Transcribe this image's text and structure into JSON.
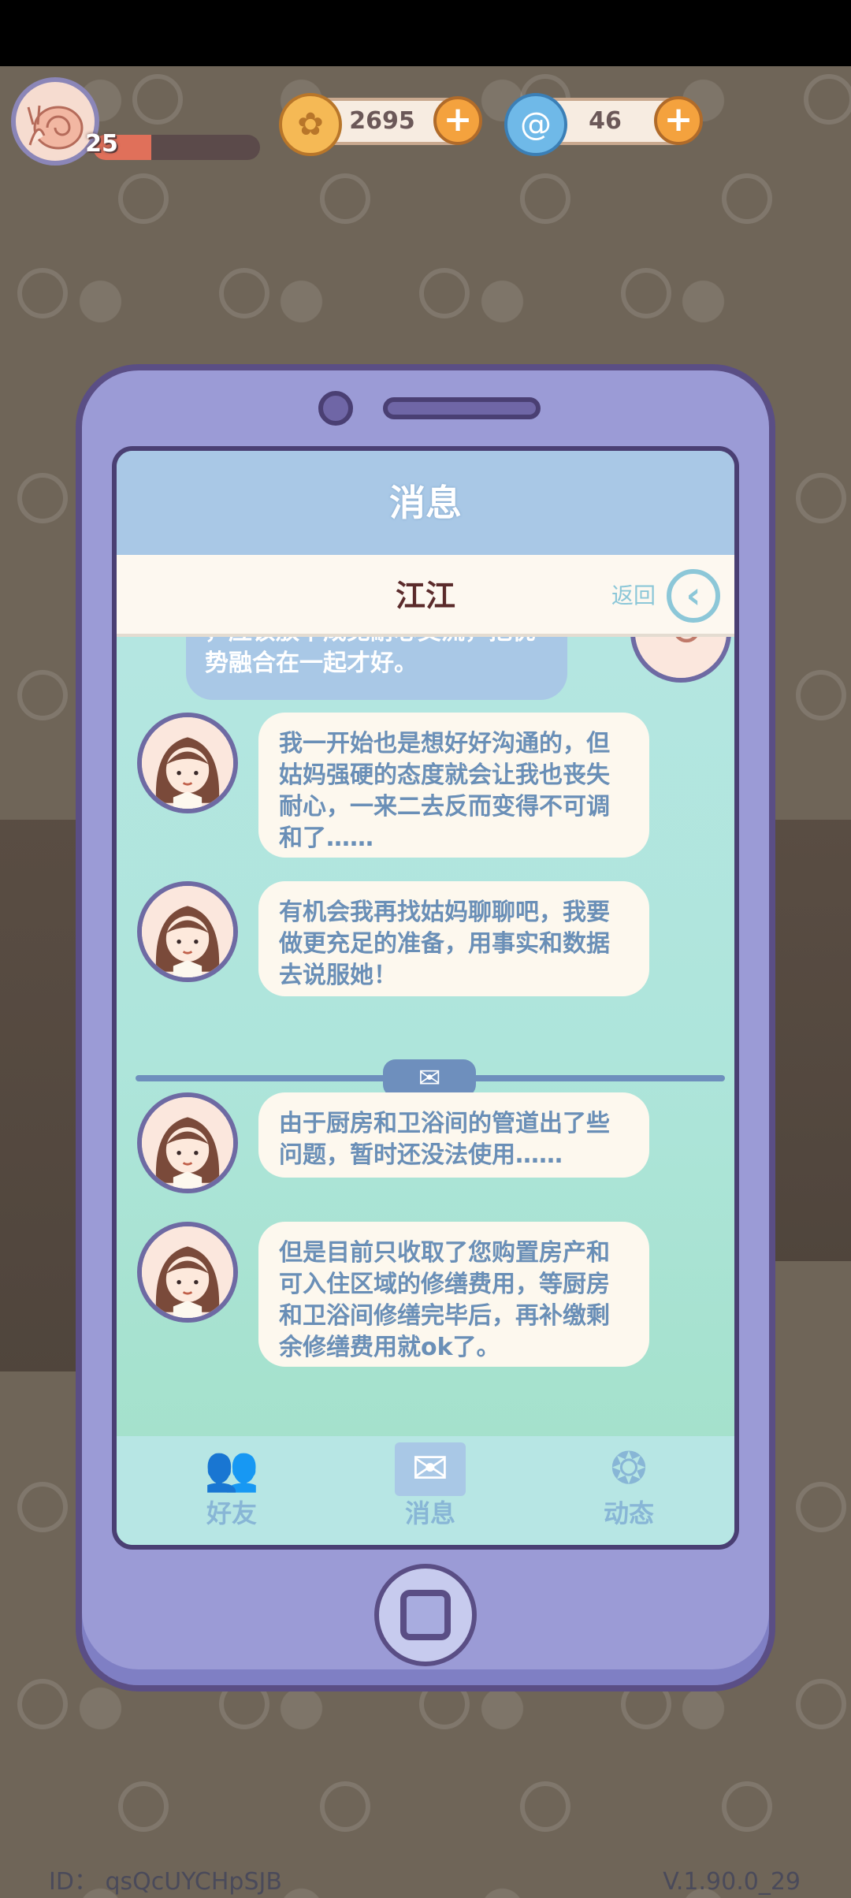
{
  "hud": {
    "level": "25",
    "level_progress": 0.35,
    "coins": "2695",
    "gems": "46"
  },
  "phone": {
    "title": "消息",
    "contact_name": "江江",
    "back_label": "返回",
    "messages": [
      {
        "from": "me",
        "text": "，应该放下成见耐心交流，把优势融合在一起才好。"
      },
      {
        "from": "contact",
        "text": "我一开始也是想好好沟通的，但姑妈强硬的态度就会让我也丧失耐心，一来二去反而变得不可调和了……"
      },
      {
        "from": "contact",
        "text": "有机会我再找姑妈聊聊吧，我要做更充足的准备，用事实和数据去说服她！"
      },
      {
        "from": "contact",
        "text": "由于厨房和卫浴间的管道出了些问题，暂时还没法使用……"
      },
      {
        "from": "contact",
        "text": "但是目前只收取了您购置房产和可入住区域的修缮费用，等厨房和卫浴间修缮完毕后，再补缴剩余修缮费用就ok了。"
      }
    ],
    "tabs": [
      {
        "label": "好友",
        "icon": "friends-icon"
      },
      {
        "label": "消息",
        "icon": "mail-icon"
      },
      {
        "label": "动态",
        "icon": "moments-icon"
      }
    ]
  },
  "footer": {
    "id": "ID： qsQcUYCHpSJB",
    "version": "V.1.90.0_29"
  },
  "colors": {
    "phone_body": "#9b9bd6",
    "header": "#a9c8e6",
    "bubble_text": "#6a8fb7",
    "accent_plus": "#f4a23e"
  }
}
